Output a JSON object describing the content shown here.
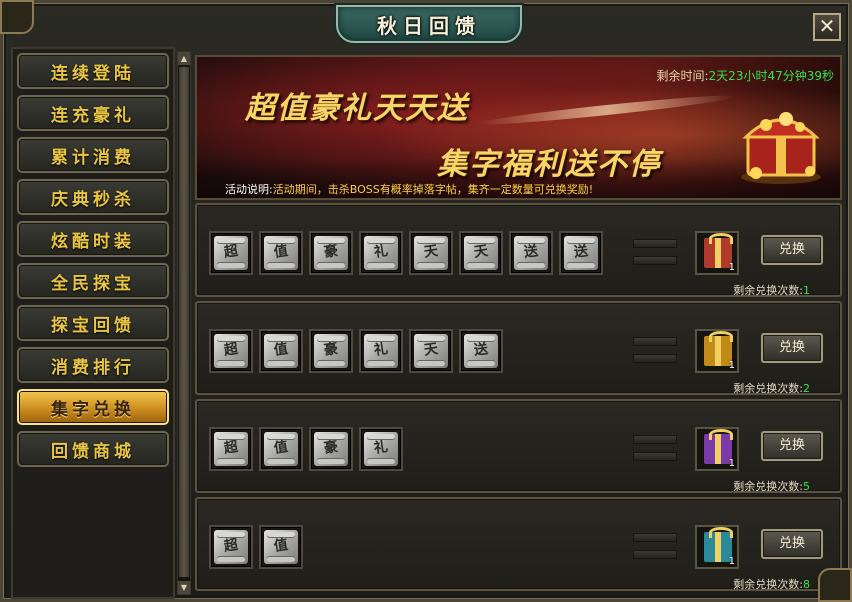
{
  "window": {
    "title": "秋日回馈",
    "close_label": "✕"
  },
  "sidebar": {
    "items": [
      {
        "label": "连续登陆"
      },
      {
        "label": "连充豪礼"
      },
      {
        "label": "累计消费"
      },
      {
        "label": "庆典秒杀"
      },
      {
        "label": "炫酷时装"
      },
      {
        "label": "全民探宝"
      },
      {
        "label": "探宝回馈"
      },
      {
        "label": "消费排行"
      },
      {
        "label": "集字兑换",
        "active": true
      },
      {
        "label": "回馈商城"
      }
    ]
  },
  "banner": {
    "slogan_1": "超值豪礼天天送",
    "slogan_2": "集字福利送不停",
    "countdown_label": "剩余时间:",
    "countdown_value": "2天23小时47分钟39秒",
    "desc_label": "活动说明:",
    "desc_text": "活动期间，击杀BOSS有概率掉落字帖，集齐一定数量可兑换奖励!"
  },
  "rewards": [
    {
      "scrolls": [
        "超",
        "值",
        "豪",
        "礼",
        "天",
        "天",
        "送",
        "送"
      ],
      "gift_color": "#b03a2e",
      "gift_count": "1",
      "button_label": "兑换",
      "remain_label": "剩余兑换次数:",
      "remain_count": "1"
    },
    {
      "scrolls": [
        "超",
        "值",
        "豪",
        "礼",
        "天",
        "送"
      ],
      "gift_color": "#c28a18",
      "gift_count": "1",
      "button_label": "兑换",
      "remain_label": "剩余兑换次数:",
      "remain_count": "2"
    },
    {
      "scrolls": [
        "超",
        "值",
        "豪",
        "礼"
      ],
      "gift_color": "#7a3aa8",
      "gift_count": "1",
      "button_label": "兑换",
      "remain_label": "剩余兑换次数:",
      "remain_count": "5"
    },
    {
      "scrolls": [
        "超",
        "值"
      ],
      "gift_color": "#2a8a9a",
      "gift_count": "1",
      "button_label": "兑换",
      "remain_label": "剩余兑换次数:",
      "remain_count": "8"
    }
  ],
  "icons": {
    "close": "close-icon",
    "scroll_up": "arrow-up-icon",
    "scroll_down": "arrow-down-icon",
    "chest": "treasure-chest-icon",
    "scroll_item": "calligraphy-scroll-icon",
    "gift": "gift-box-icon"
  },
  "colors": {
    "gold_text": "#e9c542",
    "active_tab": "#f2c84f",
    "countdown_green": "#38e04b",
    "desc_yellow": "#ffd040"
  }
}
